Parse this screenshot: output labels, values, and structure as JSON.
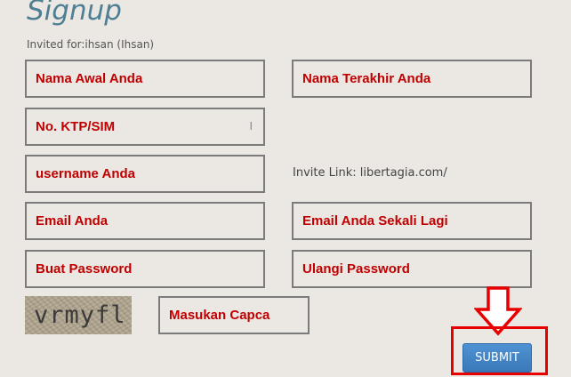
{
  "form": {
    "title": "Signup",
    "invited": "Invited for:ihsan (Ihsan)",
    "first_name_placeholder": "Nama Awal Anda",
    "last_name_placeholder": "Nama Terakhir Anda",
    "id_number_placeholder": "No. KTP/SIM",
    "username_placeholder": "username Anda",
    "invite_link": "Invite Link: libertagia.com/",
    "email_placeholder": "Email Anda",
    "email_confirm_placeholder": "Email Anda Sekali Lagi",
    "password_placeholder": "Buat Password",
    "password_confirm_placeholder": "Ulangi Password",
    "captcha_text": "vrmyfl",
    "captcha_placeholder": "Masukan Capca",
    "submit_label": "SUBMIT"
  },
  "colors": {
    "title": "#4f7f93",
    "placeholder": "#c00000",
    "highlight": "#e80000",
    "button": "#3f82c4"
  },
  "icons": {
    "highlight_arrow": "down-arrow-icon"
  }
}
